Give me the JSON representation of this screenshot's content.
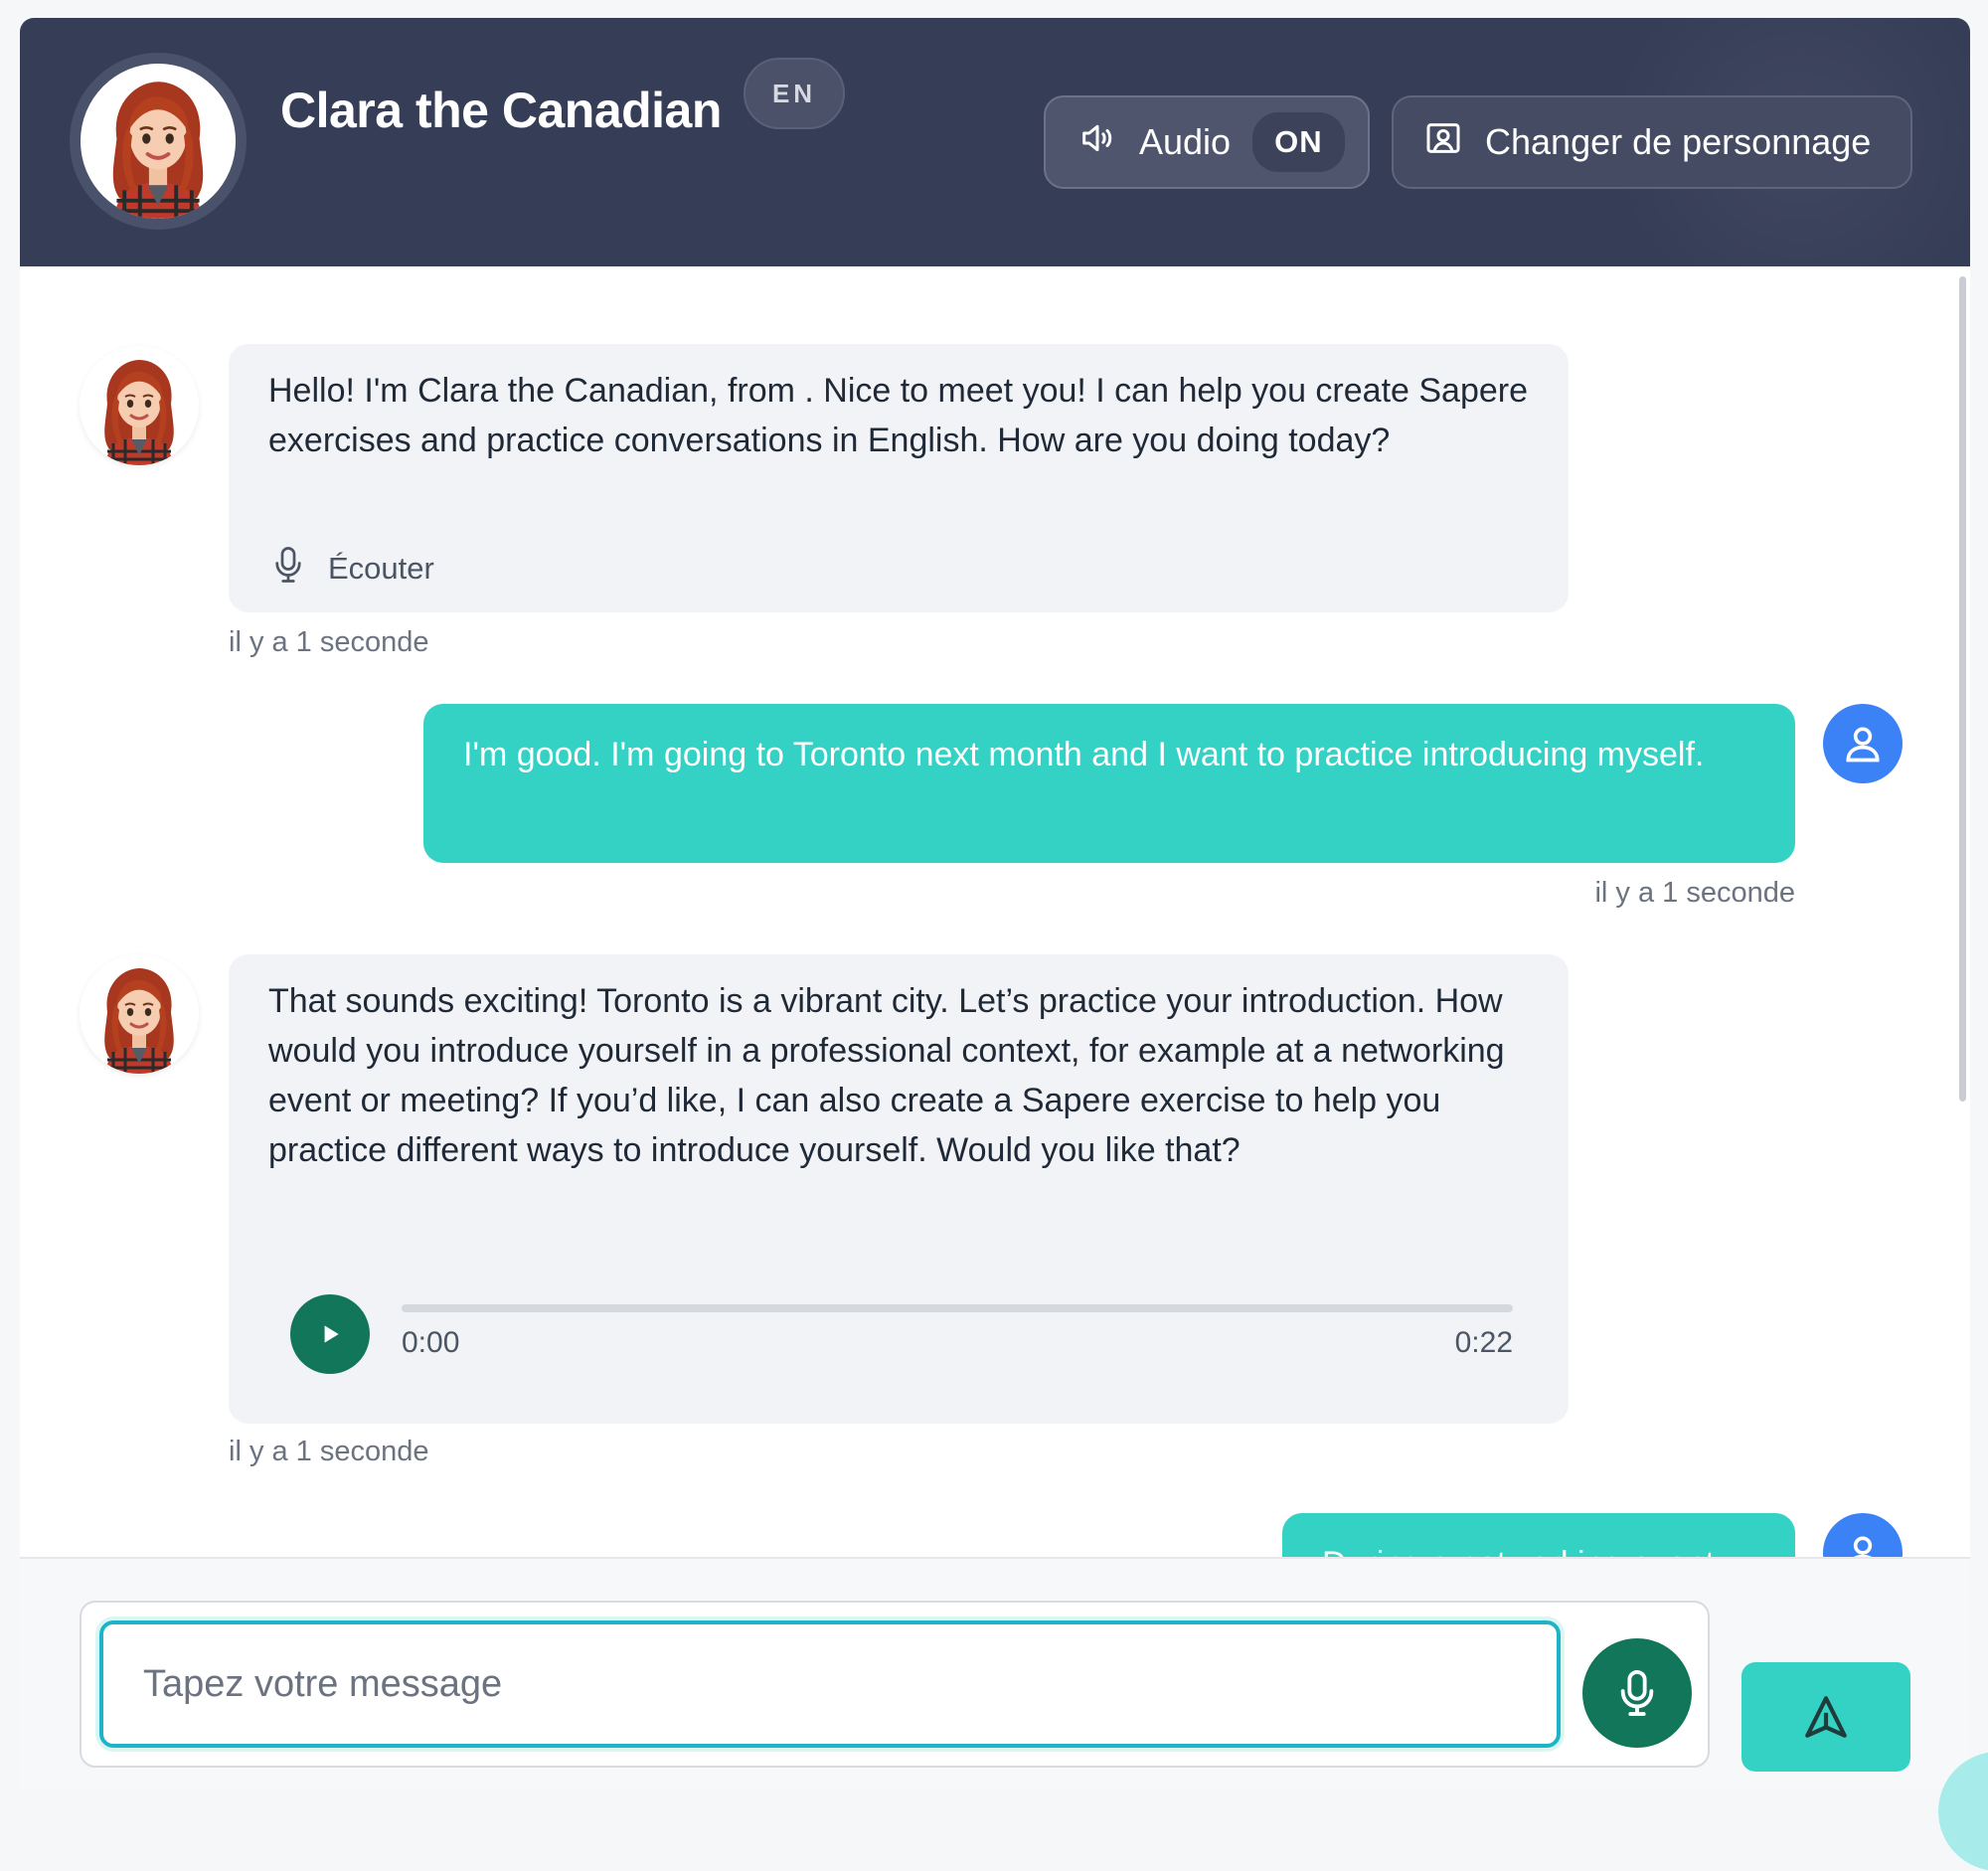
{
  "header": {
    "bot_name": "Clara the Canadian",
    "language_badge": "EN",
    "audio_label": "Audio",
    "audio_state": "ON",
    "change_character_label": "Changer de personnage"
  },
  "messages": [
    {
      "sender": "bot",
      "text": "Hello! I'm Clara the Canadian, from . Nice to meet you! I can help you create Sapere exercises and practice conversations in English. How are you doing today?",
      "listen_label": "Écouter",
      "timestamp": "il y a 1 seconde"
    },
    {
      "sender": "user",
      "text": "I'm good. I'm going to Toronto next month and I want to practice introducing myself.",
      "timestamp": "il y a 1 seconde"
    },
    {
      "sender": "bot",
      "text": "That sounds exciting! Toronto is a vibrant city. Let’s practice your introduction. How would you introduce yourself in a professional context, for example at a networking event or meeting? If you’d like, I can also create a Sapere exercise to help you practice different ways to introduce yourself. Would you like that?",
      "audio": {
        "current": "0:00",
        "duration": "0:22",
        "progress": 0
      },
      "timestamp": "il y a 1 seconde"
    },
    {
      "sender": "user",
      "text": "During a networking event."
    }
  ],
  "composer": {
    "placeholder": "Tapez votre message"
  },
  "colors": {
    "header_bg": "#363d57",
    "user_bubble": "#33d2c4",
    "bot_bubble": "#f1f3f6",
    "primary_green": "#12765a",
    "user_avatar": "#3b82f6"
  },
  "icons": {
    "audio": "speaker-icon",
    "character": "user-portrait-icon",
    "listen": "microphone-icon",
    "play": "play-icon",
    "mic": "microphone-icon",
    "send": "send-icon",
    "user_avatar": "person-icon"
  }
}
